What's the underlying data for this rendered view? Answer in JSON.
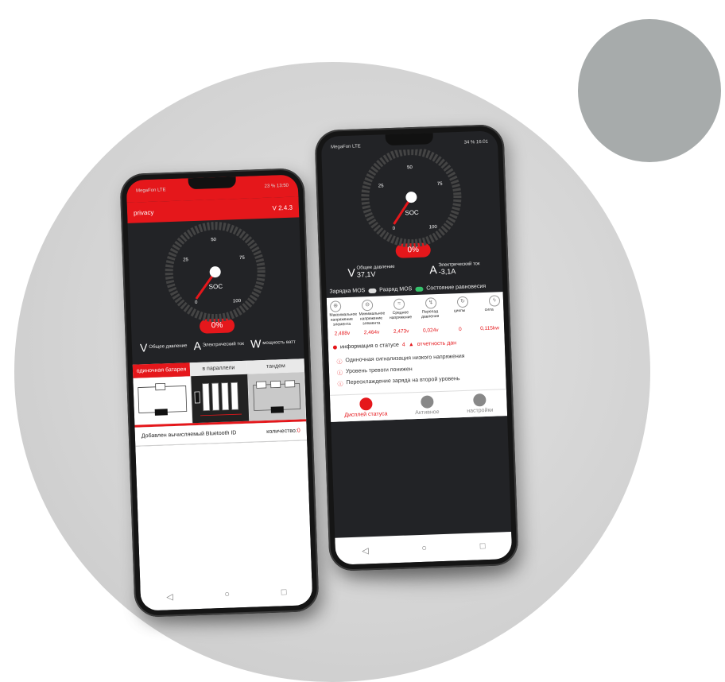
{
  "left_phone": {
    "status_left": "MegaFon LTE",
    "status_right": "23 % 13:50",
    "header": {
      "title": "privacy",
      "version": "V 2.4.3"
    },
    "gauge": {
      "label": "SOC",
      "ticks": [
        "0",
        "25",
        "50",
        "75",
        "100"
      ],
      "percent": "0%"
    },
    "metrics": [
      {
        "symbol": "V",
        "label": "Общее давление"
      },
      {
        "symbol": "A",
        "label": "Электрический ток"
      },
      {
        "symbol": "W",
        "label": "мощность ватт"
      }
    ],
    "tabs": [
      "одиночная батарея",
      "в параллели",
      "тандем"
    ],
    "bluetooth_label": "Добавлен вычисляемый Bluetooth ID",
    "count_label": "количество:",
    "count_value": "0",
    "nav": [
      "◁",
      "○",
      "□"
    ]
  },
  "right_phone": {
    "status_left": "MegaFon LTE",
    "status_right": "34 % 16:01",
    "gauge": {
      "label": "SOC",
      "ticks": [
        "0",
        "25",
        "50",
        "75",
        "100"
      ],
      "percent": "0%"
    },
    "metrics": [
      {
        "symbol": "V",
        "label": "Общее давление",
        "value": "37,1V"
      },
      {
        "symbol": "A",
        "label": "Электрический ток",
        "value": "-3,1A"
      }
    ],
    "mos": {
      "charge": "Зарядка MOS",
      "discharge": "Разряд MOS",
      "balance": "Состояние равновесия"
    },
    "cells": [
      {
        "label": "Максимальное напряжение элемента",
        "value": "2,488v"
      },
      {
        "label": "Минимальное напряжение элемента",
        "value": "2,464v"
      },
      {
        "label": "Среднее напряжение",
        "value": "2,473v"
      },
      {
        "label": "Перепад давления",
        "value": "0,024v"
      },
      {
        "label": "циклы",
        "value": "0"
      },
      {
        "label": "сила",
        "value": "0,115kw"
      }
    ],
    "info": {
      "label": "информация о статусе",
      "count": "4",
      "report": "отчетность дан"
    },
    "alerts": [
      "Одиночная сигнализация низкого напряжения",
      "Уровень тревоги понижен",
      "Переохлаждение заряда на второй уровень"
    ],
    "bottom_tabs": [
      "Дисплей статуса",
      "Активное",
      "настройки"
    ],
    "nav": [
      "◁",
      "○",
      "□"
    ]
  }
}
